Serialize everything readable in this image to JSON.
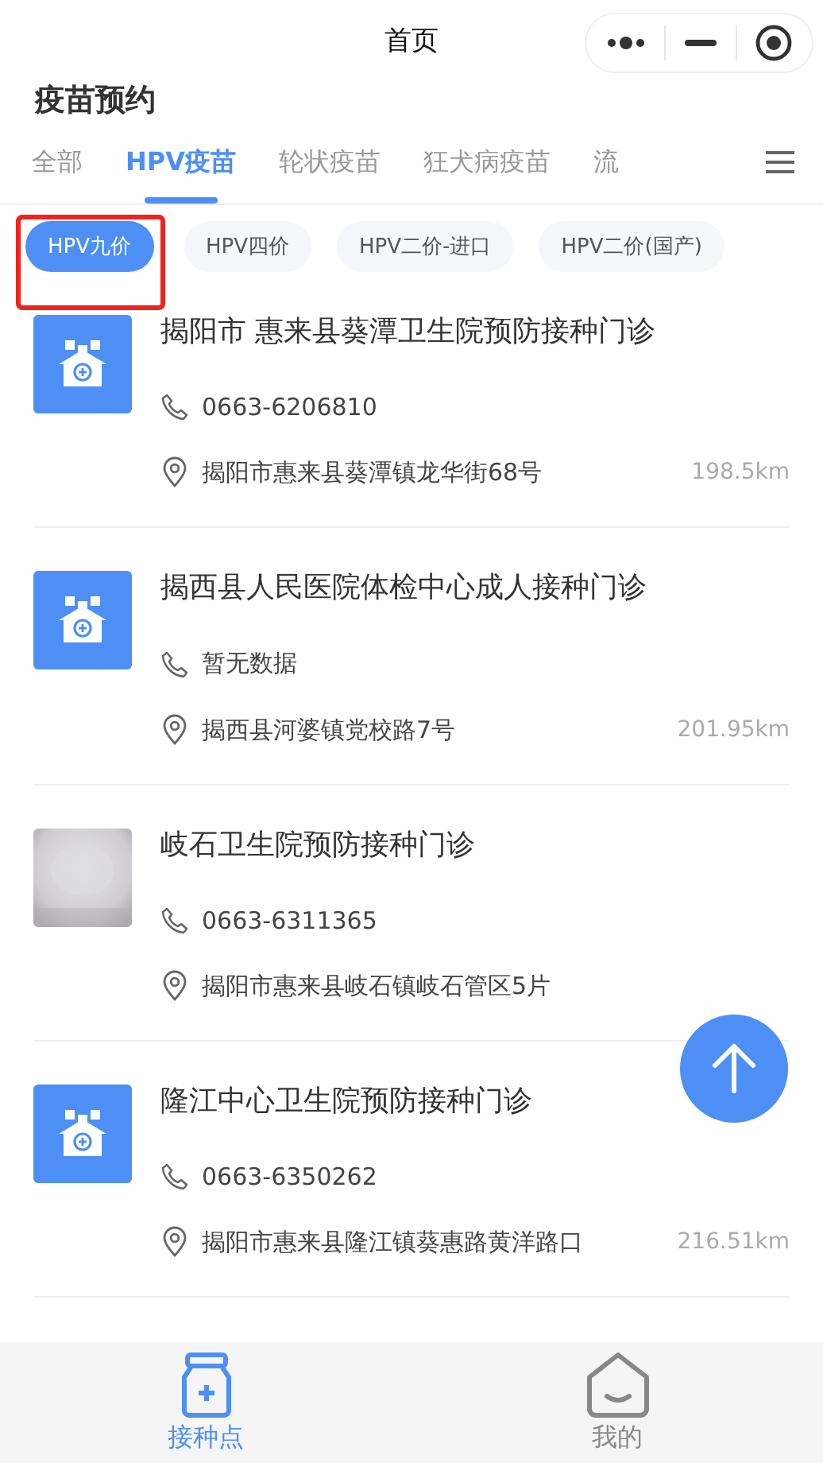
{
  "nav_bar": {
    "title": "首页"
  },
  "page_heading": "疫苗预约",
  "tabs": [
    {
      "label": "全部",
      "selected": false
    },
    {
      "label": "HPV疫苗",
      "selected": true
    },
    {
      "label": "轮状疫苗",
      "selected": false
    },
    {
      "label": "狂犬病疫苗",
      "selected": false
    },
    {
      "label": "流",
      "selected": false
    }
  ],
  "tags": [
    {
      "label": "HPV九价",
      "selected": true,
      "highlighted": true
    },
    {
      "label": "HPV四价",
      "selected": false,
      "highlighted": false
    },
    {
      "label": "HPV二价-进口",
      "selected": false,
      "highlighted": false
    },
    {
      "label": "HPV二价(国产)",
      "selected": false,
      "highlighted": false
    }
  ],
  "clinics": [
    {
      "kind": "icon",
      "name": "揭阳市 惠来县葵潭卫生院预防接种门诊",
      "phone": "0663-6206810",
      "address": "揭阳市惠来县葵潭镇龙华街68号",
      "distance": "198.5km"
    },
    {
      "kind": "icon",
      "name": "揭西县人民医院体检中心成人接种门诊",
      "phone": "暂无数据",
      "address": "揭西县河婆镇党校路7号",
      "distance": "201.95km"
    },
    {
      "kind": "picture",
      "name": "岐石卫生院预防接种门诊",
      "phone": "0663-6311365",
      "address": "揭阳市惠来县岐石镇岐石管区5片"
    },
    {
      "kind": "icon",
      "name": "隆江中心卫生院预防接种门诊",
      "phone": "0663-6350262",
      "address": "揭阳市惠来县隆江镇葵惠路黄洋路口",
      "distance": "216.51km"
    }
  ],
  "bottom_tabs": [
    {
      "kind": "clinic",
      "label": "接种点",
      "selected": true
    },
    {
      "kind": "mine",
      "label": "我的",
      "selected": false
    }
  ]
}
